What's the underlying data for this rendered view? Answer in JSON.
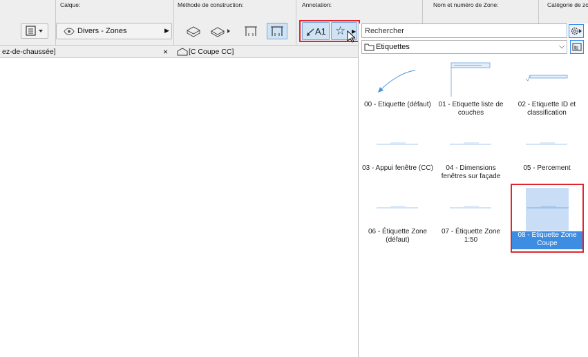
{
  "toolbar": {
    "calque_label": "Calque:",
    "layer_value": "Divers - Zones",
    "method_label": "Méthode de construction:",
    "annotation_label": "Annotation:",
    "zone_name_label": "Nom et numéro de Zone:",
    "zone_category_label": "Catégorie de zo",
    "label_button_text": "A1"
  },
  "tabs": {
    "left_tab": "ez-de-chaussée]",
    "close_glyph": "×",
    "right_tab": "[C Coupe CC]"
  },
  "panel": {
    "search_placeholder": "Rechercher",
    "folder_label": "Etiquettes",
    "items": [
      {
        "label": "00 - Etiquette (défaut)"
      },
      {
        "label": "01 - Etiquette liste de couches"
      },
      {
        "label": "02 - Etiquette ID et classification"
      },
      {
        "label": "03 - Appui fenêtre (CC)"
      },
      {
        "label": "04 - Dimensions fenêtres sur façade"
      },
      {
        "label": "05 - Percement"
      },
      {
        "label": "06 - Étiquette Zone (défaut)"
      },
      {
        "label": "07 - Étiquette Zone 1:50"
      },
      {
        "label": "08 - Étiquette Zone Coupe"
      }
    ],
    "selected_index": 8
  },
  "colors": {
    "highlight": "#e0252f",
    "selection": "#3d8de3",
    "selection_light": "#c9def6",
    "accent_button": "#cfe3f7"
  }
}
